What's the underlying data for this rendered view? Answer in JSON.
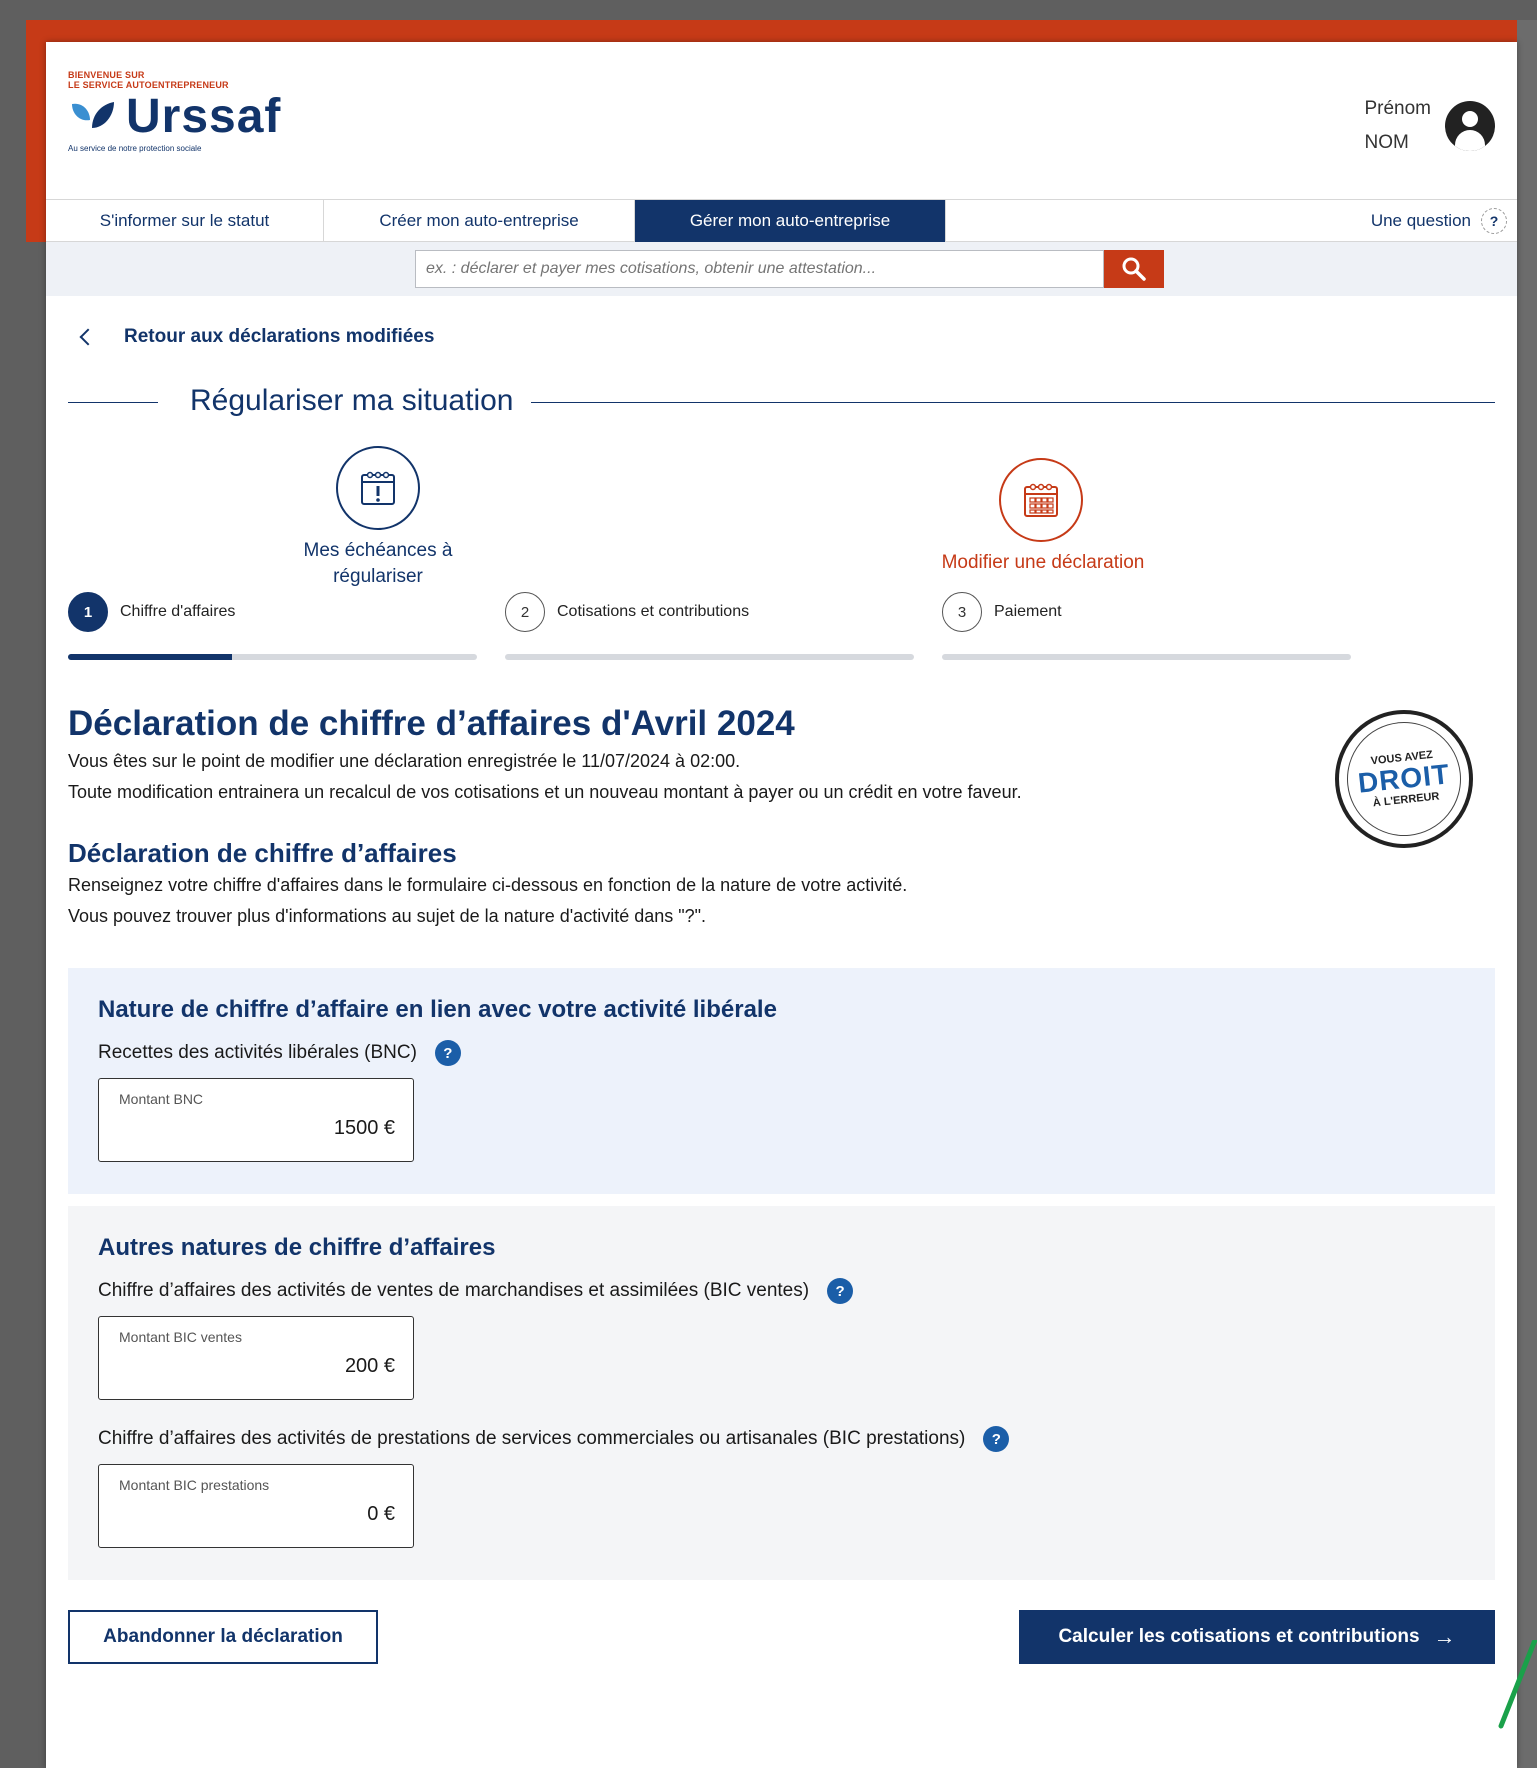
{
  "header": {
    "welcome_line1": "BIENVENUE SUR",
    "welcome_line2": "LE SERVICE AUTOENTREPRENEUR",
    "brand": "Urssaf",
    "tagline": "Au service de notre protection sociale",
    "user_first": "Prénom",
    "user_last": "NOM"
  },
  "nav": {
    "tabs": [
      {
        "label": "S'informer sur le statut"
      },
      {
        "label": "Créer mon auto-entreprise"
      },
      {
        "label": "Gérer mon auto-entreprise"
      }
    ],
    "help_label": "Une question",
    "help_symbol": "?"
  },
  "search": {
    "placeholder": "ex. : déclarer et payer mes cotisations, obtenir une attestation..."
  },
  "back_link": "Retour aux déclarations modifiées",
  "section_title": "Régulariser ma situation",
  "step_icons": [
    {
      "label": "Mes échéances à régulariser"
    },
    {
      "label": "Modifier une déclaration"
    }
  ],
  "progress_steps": [
    {
      "num": "1",
      "label": "Chiffre d'affaires",
      "progress": 0.4
    },
    {
      "num": "2",
      "label": "Cotisations et contributions",
      "progress": 0
    },
    {
      "num": "3",
      "label": "Paiement",
      "progress": 0
    }
  ],
  "main": {
    "title": "Déclaration de chiffre d’affaires d'Avril 2024",
    "intro_line1": "Vous êtes sur le point de modifier une déclaration enregistrée le 11/07/2024 à 02:00.",
    "intro_line2": "Toute modification entrainera un recalcul de vos cotisations et un nouveau montant à payer ou un crédit en votre faveur.",
    "badge_line1": "VOUS AVEZ",
    "badge_line2": "DROIT",
    "badge_line3": "À L'ERREUR",
    "subtitle": "Déclaration de chiffre d’affaires",
    "sub_line1": "Renseignez votre chiffre d'affaires dans le formulaire ci-dessous en fonction de la nature de votre activité.",
    "sub_line2": "Vous pouvez trouver plus d'informations au sujet de la nature d'activité dans \"?\"."
  },
  "panel_liberale": {
    "title": "Nature de chiffre d’affaire en lien avec votre activité libérale",
    "field_label": "Recettes des activités libérales (BNC)",
    "box_caption": "Montant BNC",
    "box_value": "1500  €"
  },
  "panel_autres": {
    "title": "Autres natures de chiffre d’affaires",
    "field1_label": "Chiffre d’affaires des activités de ventes de marchandises et assimilées (BIC ventes)",
    "box1_caption": "Montant BIC ventes",
    "box1_value": "200  €",
    "field2_label": "Chiffre d’affaires des activités de prestations de services commerciales ou artisanales (BIC prestations)",
    "box2_caption": "Montant BIC prestations",
    "box2_value": "0  €"
  },
  "actions": {
    "abandon_label": "Abandonner la déclaration",
    "calc_label": "Calculer les cotisations et contributions",
    "calc_arrow": "→"
  },
  "colors": {
    "brand_navy": "#12346a",
    "brand_orange": "#c63a17",
    "accent_blue": "#1b5ea8",
    "panel_blue": "#edf2fb"
  }
}
